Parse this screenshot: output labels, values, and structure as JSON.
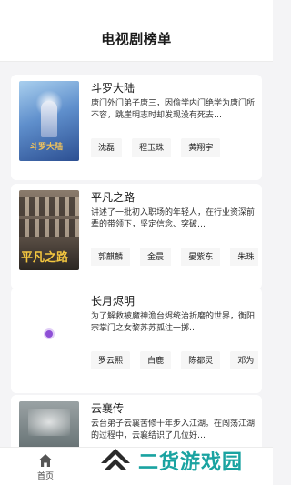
{
  "header": {
    "title": "电视剧榜单"
  },
  "dramas": [
    {
      "title": "斗罗大陆",
      "desc": "唐门外门弟子唐三，因偷学内门绝学为唐门所不容，跳崖明志时却发现没有死去…",
      "actors": [
        "沈磊",
        "程玉珠",
        "黄翔宇"
      ],
      "poster_icon": "douluo-poster"
    },
    {
      "title": "平凡之路",
      "desc": "讲述了一批初入职场的年轻人，在行业资深前辈的带领下，坚定信念、突破…",
      "actors": [
        "郭麒麟",
        "金晨",
        "晏紫东",
        "朱珠"
      ],
      "poster_icon": "pingfan-poster"
    },
    {
      "title": "长月烬明",
      "desc": "为了解救被魔神澹台烬统治折磨的世界，衡阳宗掌门之女黎苏苏孤注一掷…",
      "actors": [
        "罗云熙",
        "白鹿",
        "陈都灵",
        "邓为"
      ],
      "poster_icon": "loading-spinner"
    },
    {
      "title": "云襄传",
      "desc": "云台弟子云襄苦修十年步入江湖。在闯荡江湖的过程中，云襄结识了几位好…",
      "actors": [],
      "poster_icon": "yunxiang-poster"
    }
  ],
  "tabbar": {
    "home_label": "首页",
    "home_icon": "home-icon"
  },
  "watermark": {
    "text": "二货游戏园",
    "color": "#1aa3a1"
  },
  "colors": {
    "background": "#f4f4f6",
    "card": "#ffffff",
    "tag_bg": "#f6f6f6"
  }
}
